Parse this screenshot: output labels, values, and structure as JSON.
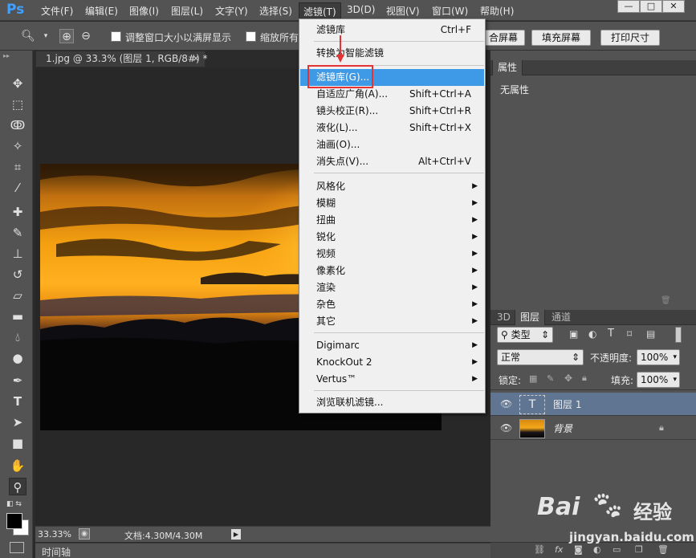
{
  "app": {
    "logo": "Ps"
  },
  "menubar": {
    "items": [
      {
        "label": "文件(F)"
      },
      {
        "label": "编辑(E)"
      },
      {
        "label": "图像(I)"
      },
      {
        "label": "图层(L)"
      },
      {
        "label": "文字(Y)"
      },
      {
        "label": "选择(S)"
      },
      {
        "label": "滤镜(T)"
      },
      {
        "label": "3D(D)"
      },
      {
        "label": "视图(V)"
      },
      {
        "label": "窗口(W)"
      },
      {
        "label": "帮助(H)"
      }
    ],
    "window_controls": {
      "minimize": "—",
      "restore": "□",
      "close": "✕"
    }
  },
  "options_bar": {
    "resize_windows_label": "调整窗口大小以满屏显示",
    "zoom_all_label": "缩放所有",
    "fill_screen_partial": "合屏幕",
    "fill_screen_label": "填充屏幕",
    "print_size_label": "打印尺寸"
  },
  "document": {
    "tab_title": "1.jpg @ 33.3% (图层 1, RGB/8#) *",
    "zoom": "33.33%",
    "doc_info": "文档:4.30M/4.30M"
  },
  "timeline": {
    "label": "时间轴"
  },
  "filter_menu": {
    "items": [
      {
        "label": "滤镜库",
        "shortcut": "Ctrl+F"
      },
      {
        "label": "转换为智能滤镜",
        "shortcut": ""
      },
      {
        "label": "滤镜库(G)...",
        "shortcut": ""
      },
      {
        "label": "自适应广角(A)...",
        "shortcut": "Shift+Ctrl+A"
      },
      {
        "label": "镜头校正(R)...",
        "shortcut": "Shift+Ctrl+R"
      },
      {
        "label": "液化(L)...",
        "shortcut": "Shift+Ctrl+X"
      },
      {
        "label": "油画(O)...",
        "shortcut": ""
      },
      {
        "label": "消失点(V)...",
        "shortcut": "Alt+Ctrl+V"
      },
      {
        "label": "风格化",
        "shortcut": ""
      },
      {
        "label": "模糊",
        "shortcut": ""
      },
      {
        "label": "扭曲",
        "shortcut": ""
      },
      {
        "label": "锐化",
        "shortcut": ""
      },
      {
        "label": "视频",
        "shortcut": ""
      },
      {
        "label": "像素化",
        "shortcut": ""
      },
      {
        "label": "渲染",
        "shortcut": ""
      },
      {
        "label": "杂色",
        "shortcut": ""
      },
      {
        "label": "其它",
        "shortcut": ""
      },
      {
        "label": "Digimarc",
        "shortcut": ""
      },
      {
        "label": "KnockOut 2",
        "shortcut": ""
      },
      {
        "label": "Vertus™",
        "shortcut": ""
      },
      {
        "label": "浏览联机滤镜...",
        "shortcut": ""
      }
    ]
  },
  "properties_panel": {
    "tab": "属性",
    "content": "无属性"
  },
  "layers_panel": {
    "tabs": [
      "3D",
      "图层",
      "通道"
    ],
    "filter_kind": "类型",
    "blend_mode": "正常",
    "opacity_label": "不透明度:",
    "opacity_value": "100%",
    "lock_label": "锁定:",
    "fill_label": "填充:",
    "fill_value": "100%",
    "layers": [
      {
        "name": "图层 1",
        "type": "text"
      },
      {
        "name": "背景",
        "type": "image"
      }
    ]
  },
  "watermark": {
    "brand": "Bai",
    "brand_cn": "经验",
    "url": "jingyan.baidu.com"
  },
  "colors": {
    "ui_gray": "#535353",
    "menu_highlight": "#3e9ae6",
    "annotation_red": "#e53333",
    "ps_blue": "#3fa0ff"
  }
}
